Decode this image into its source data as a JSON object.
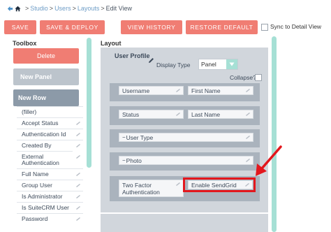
{
  "breadcrumb": {
    "items": [
      "Studio",
      "Users",
      "Layouts"
    ],
    "separator": ">",
    "current": "Edit View"
  },
  "toolbar": {
    "save": "SAVE",
    "save_deploy": "SAVE & DEPLOY",
    "view_history": "VIEW HISTORY",
    "restore_default": "RESTORE DEFAULT",
    "sync_label": "Sync to Detail View"
  },
  "toolbox": {
    "title": "Toolbox",
    "delete_label": "Delete",
    "new_panel_label": "New Panel",
    "new_row_label": "New Row",
    "items": [
      "(filler)",
      "Accept Status",
      "Authentication Id",
      "Created By",
      "External Authentication",
      "Full Name",
      "Group User",
      "Is Administrator",
      "Is SuiteCRM User",
      "Password"
    ]
  },
  "layout": {
    "title": "Layout",
    "panel": {
      "label": "User Profile",
      "display_type_label": "Display Type",
      "display_type_value": "Panel",
      "collapse_label": "Collapse?"
    },
    "rows": [
      {
        "fields": [
          "Username",
          "First Name"
        ]
      },
      {
        "fields": [
          "Status",
          "Last Name"
        ]
      },
      {
        "fields": [
          "User Type"
        ]
      },
      {
        "fields": [
          "Photo"
        ]
      },
      {
        "fields": [
          "Two Factor Authentication",
          "Enable SendGrid"
        ]
      }
    ]
  },
  "colors": {
    "accent_button": "#f07d73",
    "teal": "#a6e0d5",
    "highlight": "#e3171d"
  },
  "icons": {
    "back": "back-arrow-icon",
    "home": "home-icon",
    "edit": "pencil-icon",
    "dropdown": "chevron-down-icon"
  }
}
